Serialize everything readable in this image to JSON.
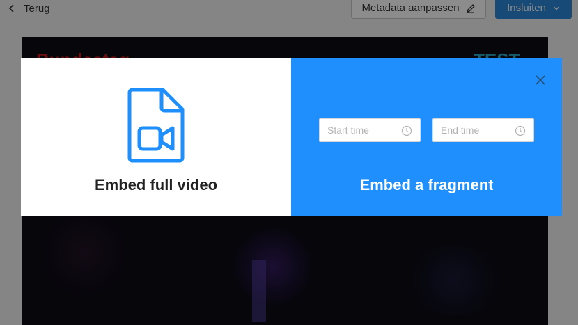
{
  "header": {
    "back_label": "Terug",
    "metadata_button_label": "Metadata aanpassen",
    "insert_button_label": "Insluiten"
  },
  "video": {
    "title_left": "Bundestag",
    "title_right": "TEST"
  },
  "modal": {
    "full_video_label": "Embed full video",
    "fragment_label": "Embed a fragment",
    "start_time_placeholder": "Start time",
    "end_time_placeholder": "End time",
    "start_time_value": "",
    "end_time_value": ""
  },
  "colors": {
    "accent": "#1e8ffc",
    "primary_button": "#2b88d8",
    "overlay": "rgba(0,0,0,0.45)",
    "icon_blue": "#1e8ffc"
  },
  "icons": {
    "back": "chevron-left-icon",
    "edit": "pencil-icon",
    "dropdown": "chevron-down-icon",
    "file": "video-file-icon",
    "close": "close-icon",
    "clock": "clock-icon"
  }
}
